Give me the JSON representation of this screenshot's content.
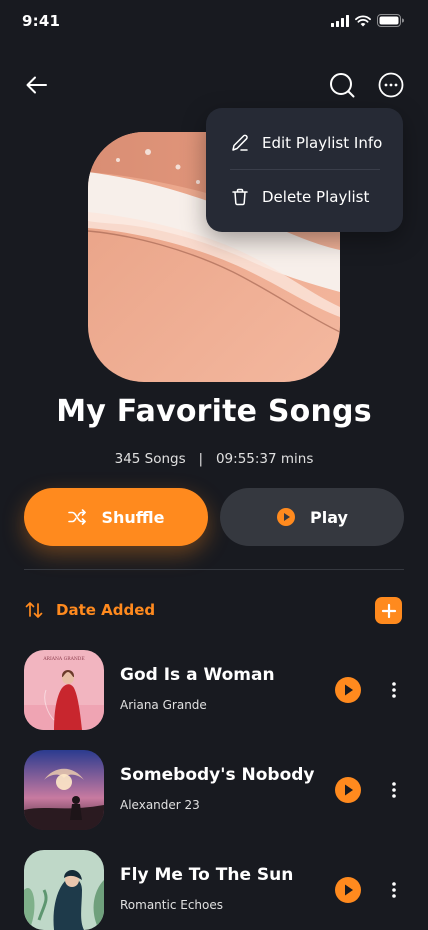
{
  "status_bar": {
    "time": "9:41",
    "icons": [
      "signal-icon",
      "wifi-icon",
      "battery-icon"
    ]
  },
  "top_bar": {
    "back_icon": "arrow-left-icon",
    "search_icon": "search-icon",
    "more_icon": "more-circle-icon"
  },
  "menu": {
    "items": [
      {
        "label": "Edit Playlist Info",
        "icon": "edit-icon"
      },
      {
        "label": "Delete Playlist",
        "icon": "trash-icon"
      }
    ]
  },
  "playlist": {
    "title": "My Favorite Songs",
    "song_count": "345 Songs",
    "separator": "|",
    "duration": "09:55:37 mins"
  },
  "actions": {
    "shuffle_label": "Shuffle",
    "play_label": "Play"
  },
  "sort": {
    "label": "Date Added",
    "icon": "sort-icon",
    "add_icon": "plus-icon"
  },
  "songs": [
    {
      "title": "God Is a Woman",
      "artist": "Ariana Grande",
      "art_caption": "ARIANA GRANDE"
    },
    {
      "title": "Somebody's Nobody",
      "artist": "Alexander 23"
    },
    {
      "title": "Fly Me To The Sun",
      "artist": "Romantic Echoes"
    }
  ],
  "colors": {
    "background": "#181A20",
    "accent": "#FF8A1E",
    "surface": "#35383F",
    "menu_surface": "#262A35"
  }
}
